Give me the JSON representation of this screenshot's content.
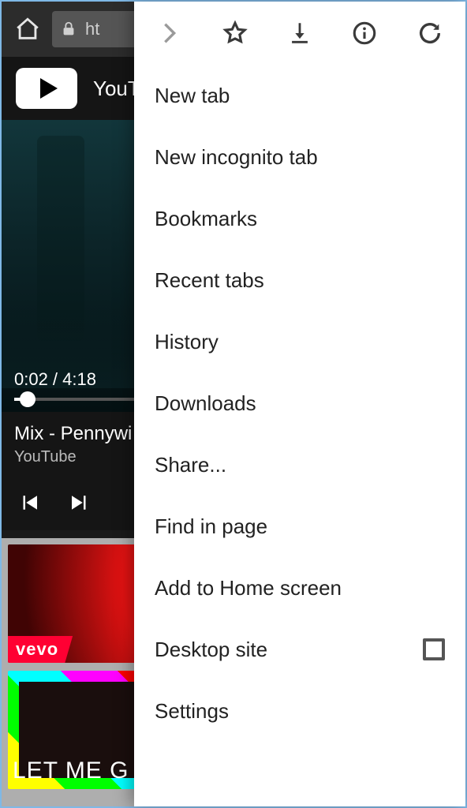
{
  "browser": {
    "url_text": "ht"
  },
  "youtube": {
    "header_label": "YouTu",
    "video": {
      "time_label": "0:02 / 4:18",
      "title": "Mix - Pennywi",
      "subtitle": "YouTube"
    },
    "thumbnails": {
      "vevo_label": "vevo",
      "second_caption": "LET ME G"
    }
  },
  "menu": {
    "items": [
      {
        "label": "New tab"
      },
      {
        "label": "New incognito tab"
      },
      {
        "label": "Bookmarks"
      },
      {
        "label": "Recent tabs"
      },
      {
        "label": "History"
      },
      {
        "label": "Downloads"
      },
      {
        "label": "Share..."
      },
      {
        "label": "Find in page"
      },
      {
        "label": "Add to Home screen"
      },
      {
        "label": "Desktop site",
        "checkbox": true
      },
      {
        "label": "Settings"
      }
    ]
  }
}
